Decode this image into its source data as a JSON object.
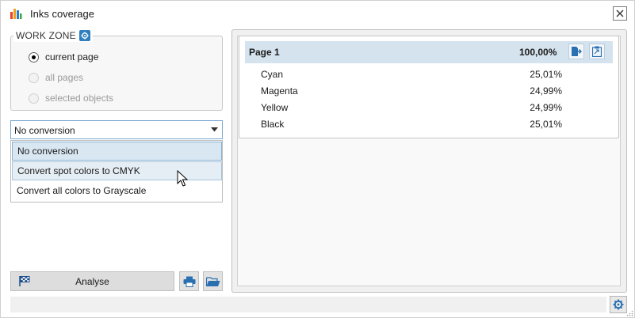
{
  "window": {
    "title": "Inks coverage",
    "icon": "bar-chart-icon",
    "close_icon": "close-icon"
  },
  "workzone": {
    "legend": "WORK ZONE",
    "legend_icon": "gear-icon",
    "options": [
      {
        "label": "current page",
        "checked": true,
        "enabled": true
      },
      {
        "label": "all pages",
        "checked": false,
        "enabled": false
      },
      {
        "label": "selected objects",
        "checked": false,
        "enabled": false
      }
    ]
  },
  "conversion": {
    "selected": "No conversion",
    "options": [
      "No conversion",
      "Convert spot colors to CMYK",
      "Convert all colors to Grayscale"
    ]
  },
  "actions": {
    "analyse_label": "Analyse",
    "analyse_icon": "checkered-flag-icon",
    "print_icon": "printer-icon",
    "open_icon": "folder-open-icon"
  },
  "results": {
    "page_title": "Page 1",
    "total": "100,00%",
    "export_icon": "export-icon",
    "copy_icon": "clipboard-icon",
    "inks": [
      {
        "name": "Cyan",
        "value": "25,01%"
      },
      {
        "name": "Magenta",
        "value": "24,99%"
      },
      {
        "name": "Yellow",
        "value": "24,99%"
      },
      {
        "name": "Black",
        "value": "25,01%"
      }
    ]
  },
  "statusbar": {
    "settings_icon": "gear-icon"
  },
  "colors": {
    "accent": "#2f7fc0",
    "header_bg": "#d5e3ee",
    "selected_bg": "#d9e7f2"
  }
}
